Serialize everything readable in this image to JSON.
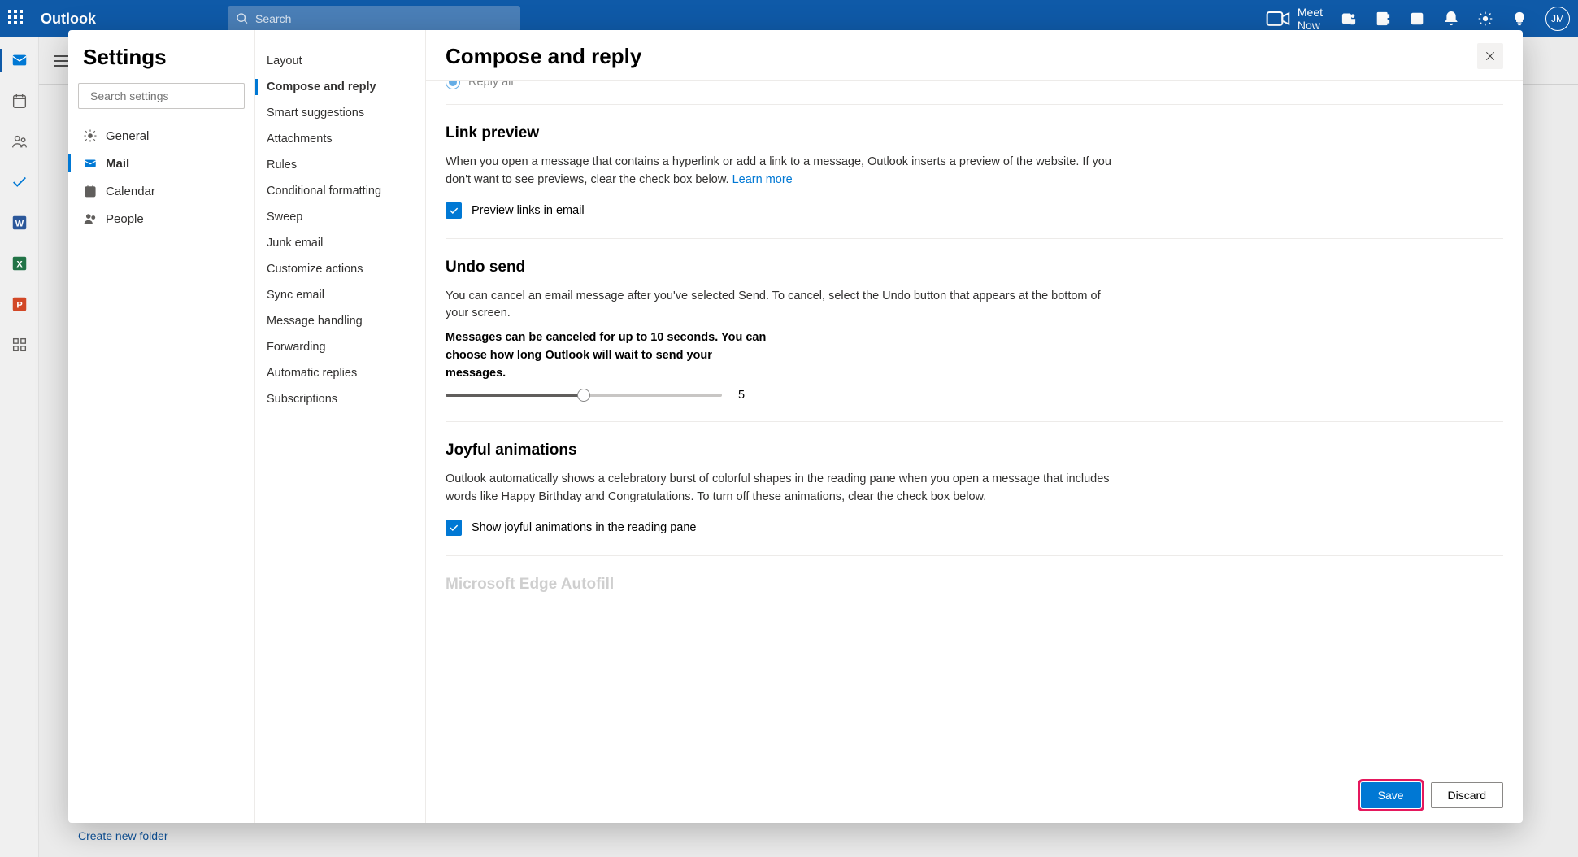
{
  "header": {
    "app_title": "Outlook",
    "search_placeholder": "Search",
    "meet_now": "Meet Now",
    "avatar_initials": "JM"
  },
  "bg": {
    "create_folder": "Create new folder"
  },
  "settings": {
    "title": "Settings",
    "search_placeholder": "Search settings",
    "categories": [
      {
        "id": "general",
        "label": "General"
      },
      {
        "id": "mail",
        "label": "Mail"
      },
      {
        "id": "calendar",
        "label": "Calendar"
      },
      {
        "id": "people",
        "label": "People"
      }
    ],
    "subitems": [
      "Layout",
      "Compose and reply",
      "Smart suggestions",
      "Attachments",
      "Rules",
      "Conditional formatting",
      "Sweep",
      "Junk email",
      "Customize actions",
      "Sync email",
      "Message handling",
      "Forwarding",
      "Automatic replies",
      "Subscriptions"
    ],
    "content": {
      "page_title": "Compose and reply",
      "reply_all_label": "Reply all",
      "link_preview": {
        "heading": "Link preview",
        "body": "When you open a message that contains a hyperlink or add a link to a message, Outlook inserts a preview of the website. If you don't want to see previews, clear the check box below.",
        "learn_more": "Learn more",
        "checkbox_label": "Preview links in email"
      },
      "undo_send": {
        "heading": "Undo send",
        "body": "You can cancel an email message after you've selected Send. To cancel, select the Undo button that appears at the bottom of your screen.",
        "slider_text": "Messages can be canceled for up to 10 seconds. You can choose how long Outlook will wait to send your messages.",
        "slider_value": "5"
      },
      "joyful": {
        "heading": "Joyful animations",
        "body": "Outlook automatically shows a celebratory burst of colorful shapes in the reading pane when you open a message that includes words like Happy Birthday and Congratulations. To turn off these animations, clear the check box below.",
        "checkbox_label": "Show joyful animations in the reading pane"
      },
      "edge_autofill": {
        "heading": "Microsoft Edge Autofill"
      },
      "save_label": "Save",
      "discard_label": "Discard"
    }
  }
}
